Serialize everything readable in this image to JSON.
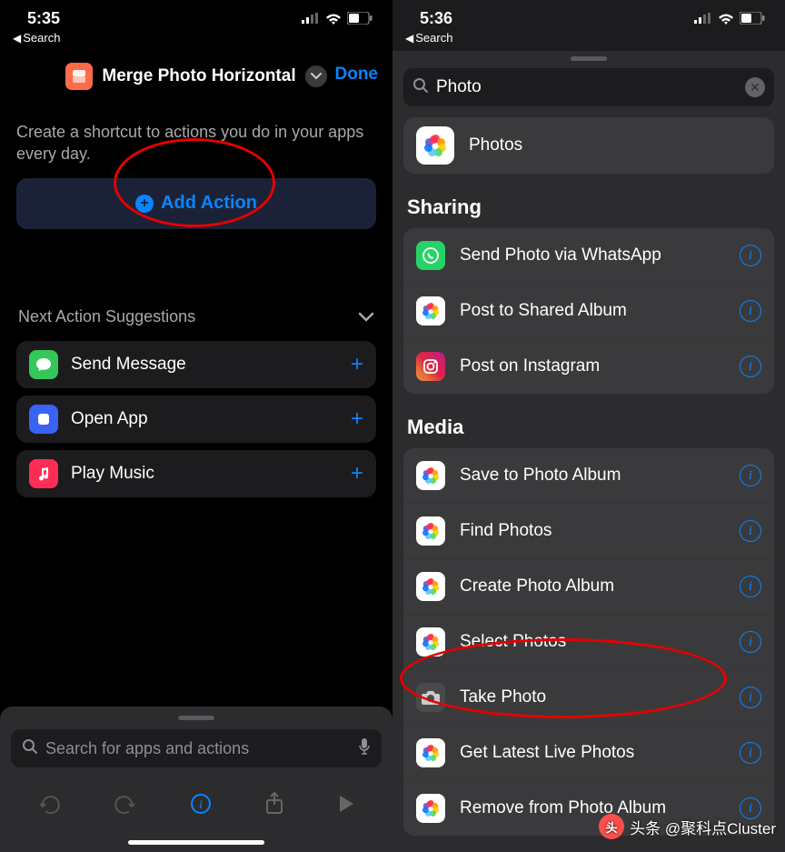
{
  "left": {
    "status_time": "5:35",
    "back_label": "Search",
    "shortcut_title": "Merge Photo Horizontal",
    "done_label": "Done",
    "hint": "Create a shortcut to actions you do in your apps every day.",
    "add_action_label": "Add Action",
    "suggestions_title": "Next Action Suggestions",
    "suggestions": [
      {
        "label": "Send Message",
        "icon": "message-icon"
      },
      {
        "label": "Open App",
        "icon": "app-icon"
      },
      {
        "label": "Play Music",
        "icon": "music-icon"
      }
    ],
    "search_placeholder": "Search for apps and actions"
  },
  "right": {
    "status_time": "5:36",
    "back_label": "Search",
    "search_value": "Photo",
    "app_result": "Photos",
    "sections": [
      {
        "title": "Sharing",
        "items": [
          {
            "label": "Send Photo via WhatsApp",
            "icon": "whatsapp-icon"
          },
          {
            "label": "Post to Shared Album",
            "icon": "photos-icon"
          },
          {
            "label": "Post on Instagram",
            "icon": "instagram-icon"
          }
        ]
      },
      {
        "title": "Media",
        "items": [
          {
            "label": "Save to Photo Album",
            "icon": "photos-icon"
          },
          {
            "label": "Find Photos",
            "icon": "photos-icon"
          },
          {
            "label": "Create Photo Album",
            "icon": "photos-icon"
          },
          {
            "label": "Select Photos",
            "icon": "photos-icon"
          },
          {
            "label": "Take Photo",
            "icon": "camera-icon"
          },
          {
            "label": "Get Latest Live Photos",
            "icon": "photos-icon"
          },
          {
            "label": "Remove from Photo Album",
            "icon": "photos-icon"
          }
        ]
      }
    ]
  },
  "watermark": "头条 @聚科点Cluster"
}
